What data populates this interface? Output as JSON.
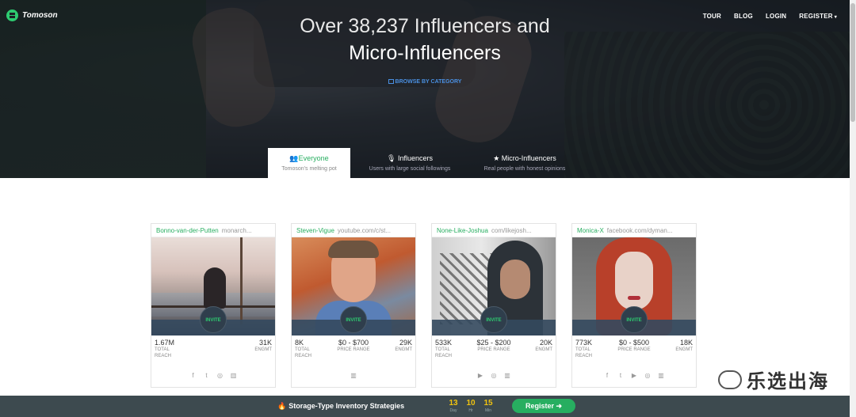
{
  "brand": {
    "name": "Tomoson"
  },
  "nav": {
    "items": [
      "TOUR",
      "BLOG",
      "LOGIN",
      "REGISTER"
    ]
  },
  "hero": {
    "title_line1": "Over 38,237 Influencers and",
    "title_line2": "Micro-Influencers",
    "browse_label": "BROWSE BY CATEGORY"
  },
  "tabs": [
    {
      "label": "Everyone",
      "sub": "Tomoson's melting pot",
      "icon": "users-icon",
      "active": true
    },
    {
      "label": "Influencers",
      "sub": "Users with large social followings",
      "icon": "microphone-icon",
      "active": false
    },
    {
      "label": "Micro-Influencers",
      "sub": "Real people with honest opinions",
      "icon": "star-icon",
      "active": false
    }
  ],
  "cards": [
    {
      "name": "Bonno-van-der-Putten",
      "handle": "monarch...",
      "invite": "INVITE",
      "reach": "1.67M",
      "reach_label_1": "TOTAL",
      "reach_label_2": "REACH",
      "price": "",
      "price_label": "",
      "engmt": "31K",
      "engmt_label": "ENGMT",
      "socials": [
        "f",
        "t",
        "◎",
        "▥"
      ]
    },
    {
      "name": "Steven-Vigue",
      "handle": "youtube.com/c/st...",
      "invite": "INVITE",
      "reach": "8K",
      "reach_label_1": "TOTAL",
      "reach_label_2": "REACH",
      "price": "$0 - $700",
      "price_label": "PRICE RANGE",
      "engmt": "29K",
      "engmt_label": "ENGMT",
      "socials": [
        "▥"
      ]
    },
    {
      "name": "None-Like-Joshua",
      "handle": "com/likejosh...",
      "invite": "INVITE",
      "reach": "533K",
      "reach_label_1": "TOTAL",
      "reach_label_2": "REACH",
      "price": "$25 - $200",
      "price_label": "PRICE RANGE",
      "engmt": "20K",
      "engmt_label": "ENGMT",
      "socials": [
        "▶",
        "◎",
        "▥"
      ]
    },
    {
      "name": "Monica-X",
      "handle": "facebook.com/dyman...",
      "invite": "INVITE",
      "reach": "773K",
      "reach_label_1": "TOTAL",
      "reach_label_2": "REACH",
      "price": "$0 - $500",
      "price_label": "PRICE RANGE",
      "engmt": "18K",
      "engmt_label": "ENGMT",
      "socials": [
        "f",
        "t",
        "▶",
        "◎",
        "▥"
      ]
    }
  ],
  "promo": {
    "title": "Storage-Type Inventory Strategies",
    "countdown": [
      {
        "value": "13",
        "unit": "Day"
      },
      {
        "value": "10",
        "unit": "Hr"
      },
      {
        "value": "15",
        "unit": "Min"
      }
    ],
    "register_label": "Register ➜"
  },
  "watermark": {
    "text": "乐选出海"
  }
}
